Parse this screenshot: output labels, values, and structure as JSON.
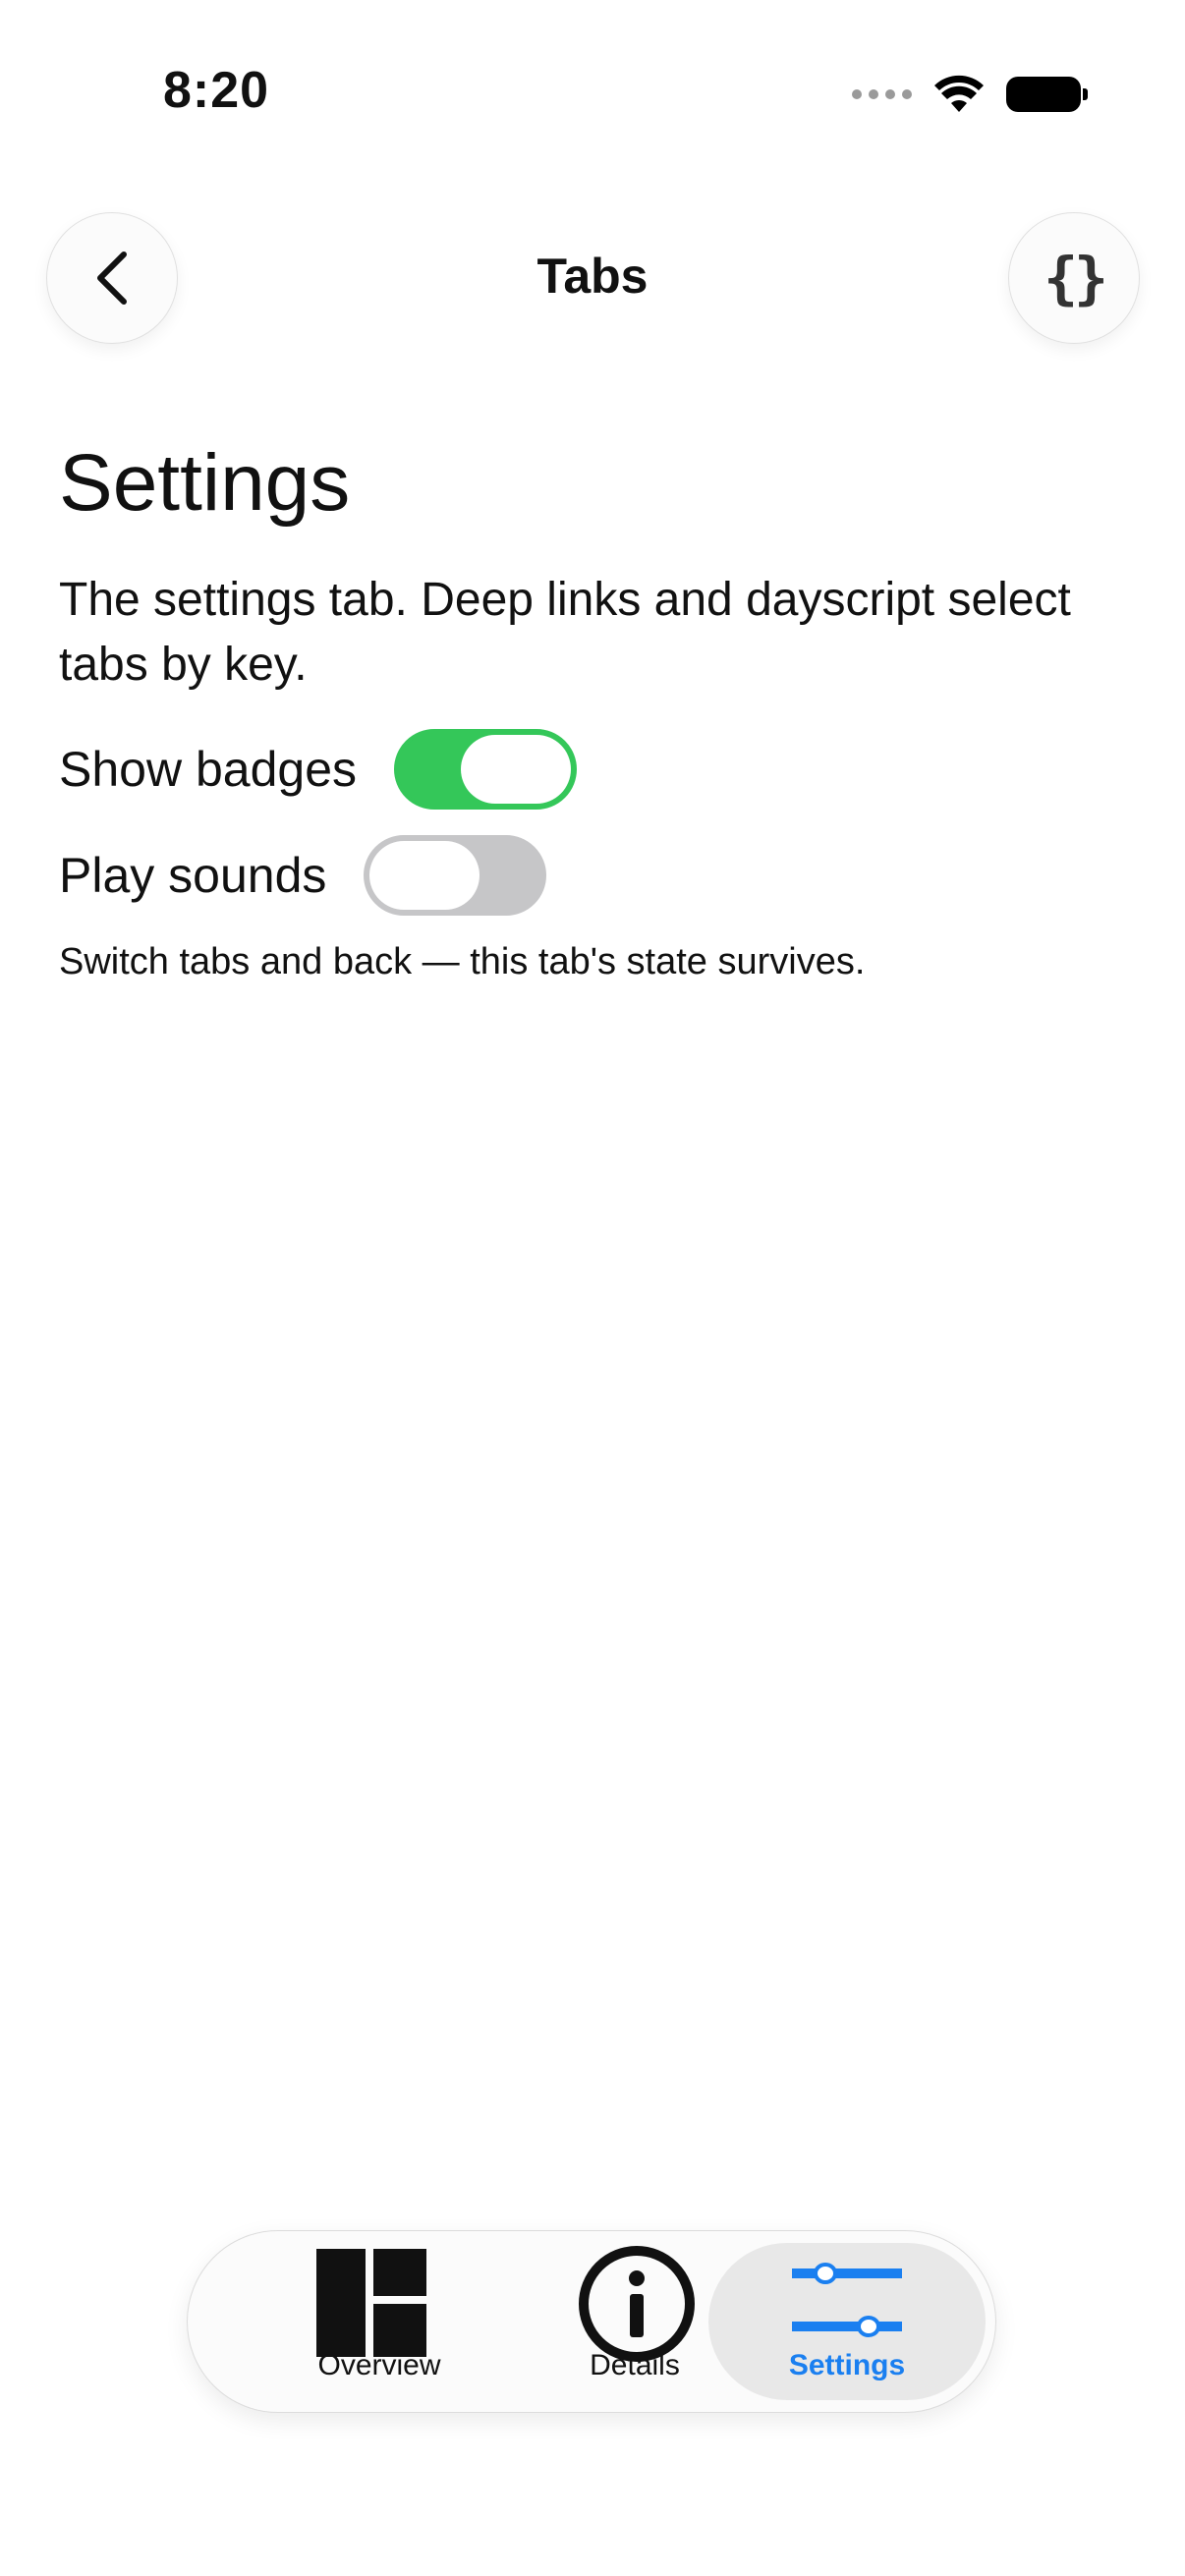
{
  "status_bar": {
    "time": "8:20"
  },
  "nav": {
    "title": "Tabs"
  },
  "content": {
    "title": "Settings",
    "description": "The settings tab. Deep links and dayscript select tabs by key.",
    "toggles": [
      {
        "label": "Show badges",
        "on": true
      },
      {
        "label": "Play sounds",
        "on": false
      }
    ],
    "footnote": "Switch tabs and back — this tab's state survives."
  },
  "tab_bar": {
    "items": [
      {
        "label": "Overview",
        "icon": "overview-layout-icon",
        "selected": false
      },
      {
        "label": "Details",
        "icon": "info-icon",
        "selected": false
      },
      {
        "label": "Settings",
        "icon": "sliders-icon",
        "selected": true
      }
    ]
  },
  "colors": {
    "toggle_on": "#34c759",
    "toggle_off": "#c6c6c8",
    "accent": "#1a7ff0"
  }
}
